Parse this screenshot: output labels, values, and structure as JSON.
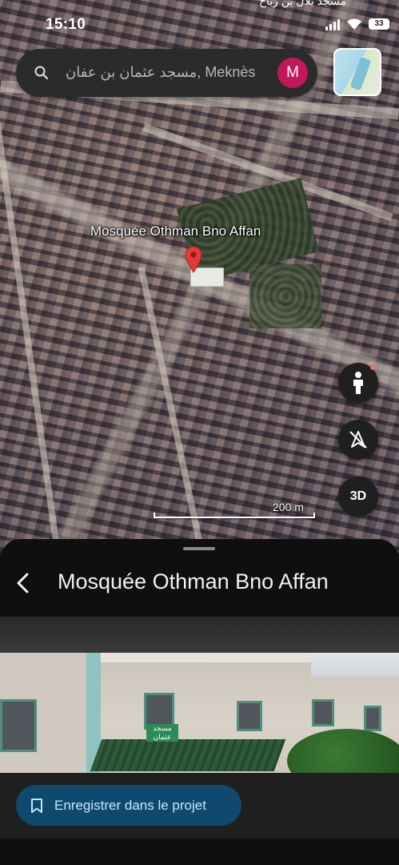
{
  "status_bar": {
    "time": "15:10",
    "overlay_text": "مسجد بلال بن رباح",
    "battery": "33"
  },
  "search": {
    "query": "مسجد عثمان بن عفان, Meknès",
    "avatar_letter": "M"
  },
  "map": {
    "place_label": "Mosquée Othman Bno Affan",
    "scale_label": "200 m",
    "three_d_label": "3D"
  },
  "sheet": {
    "title": "Mosquée Othman Bno Affan",
    "photo_sign_text": "مسجد\nعثمان",
    "save_button_label": "Enregistrer dans le projet"
  },
  "colors": {
    "accent_pin": "#e53935",
    "avatar_bg": "#c2185b",
    "save_button_bg": "#0f4a6e"
  }
}
